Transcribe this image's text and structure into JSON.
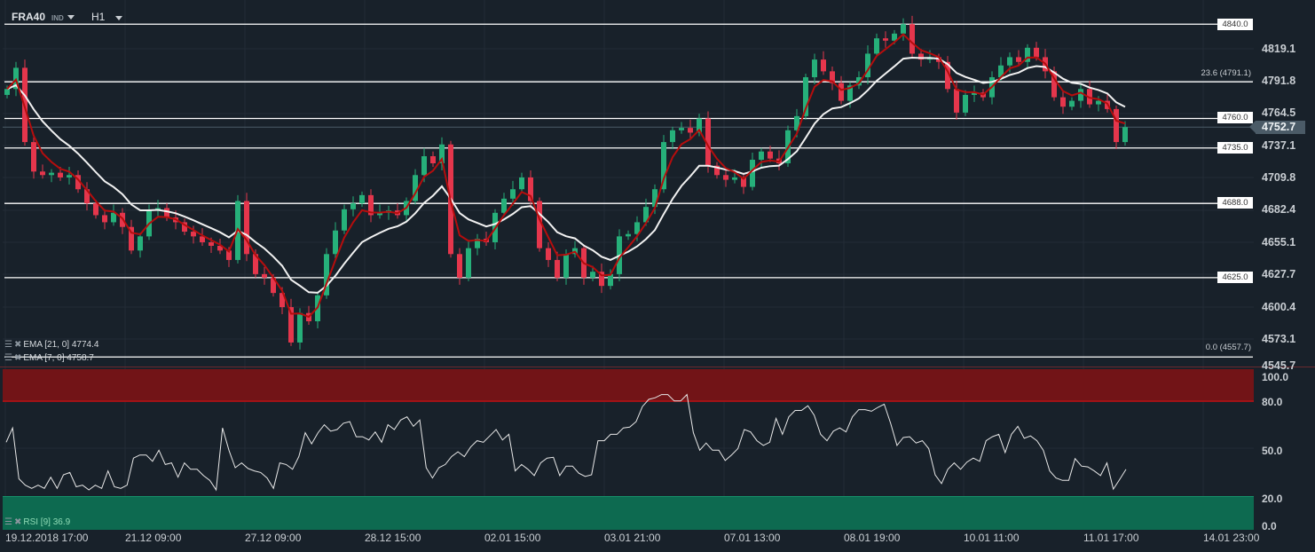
{
  "header": {
    "symbol": "FRA40",
    "instrument_type": "IND",
    "timeframe": "H1"
  },
  "price_axis": [
    "4819.1",
    "4791.8",
    "4764.5",
    "4737.1",
    "4709.8",
    "4682.4",
    "4655.1",
    "4627.7",
    "4600.4",
    "4573.1",
    "4545.7"
  ],
  "levels": [
    {
      "value": 4840.0,
      "label": "4840.0"
    },
    {
      "value": 4760.0,
      "label": "4760.0"
    },
    {
      "value": 4735.0,
      "label": "4735.0"
    },
    {
      "value": 4688.0,
      "label": "4688.0"
    },
    {
      "value": 4625.0,
      "label": "4625.0"
    }
  ],
  "fibonacci": [
    {
      "value": 4791.1,
      "label": "23.6 (4791.1)"
    },
    {
      "value": 4557.7,
      "label": "0.0 (4557.7)"
    }
  ],
  "current_price": "4752.7",
  "indicators": {
    "ema21": "EMA [21, 0] 4774.4",
    "ema7": "EMA [7, 0] 4758.7",
    "rsi": "RSI [9] 36.9"
  },
  "rsi_axis": [
    "100.0",
    "80.0",
    "50.0",
    "20.0",
    "0.0"
  ],
  "time_axis": [
    "19.12.2018  17:00",
    "21.12  09:00",
    "27.12  09:00",
    "28.12  15:00",
    "02.01  15:00",
    "03.01  21:00",
    "07.01  13:00",
    "08.01  19:00",
    "10.01  11:00",
    "11.01  17:00",
    "14.01  23:00"
  ],
  "colors": {
    "up": "#26b07a",
    "down": "#e5364c",
    "ema21": "#f2f2f2",
    "ema7": "#b50d0d",
    "overbought": "#721417",
    "oversold": "#0d6a50"
  },
  "chart_data": {
    "type": "candlestick",
    "symbol": "FRA40",
    "timeframe": "H1",
    "ylim": [
      4545.7,
      4840.0
    ],
    "first_open": 4780,
    "closes": [
      4785,
      4803,
      4740,
      4715,
      4712,
      4714,
      4710,
      4712,
      4700,
      4688,
      4678,
      4672,
      4680,
      4668,
      4648,
      4660,
      4682,
      4684,
      4676,
      4672,
      4664,
      4660,
      4655,
      4652,
      4648,
      4640,
      4690,
      4645,
      4628,
      4625,
      4612,
      4600,
      4570,
      4595,
      4588,
      4610,
      4645,
      4665,
      4683,
      4688,
      4695,
      4678,
      4680,
      4682,
      4678,
      4690,
      4712,
      4728,
      4722,
      4738,
      4645,
      4625,
      4650,
      4658,
      4655,
      4680,
      4692,
      4700,
      4710,
      4690,
      4650,
      4640,
      4625,
      4645,
      4650,
      4625,
      4630,
      4618,
      4628,
      4660,
      4662,
      4672,
      4685,
      4700,
      4740,
      4750,
      4752,
      4748,
      4760,
      4720,
      4712,
      4708,
      4710,
      4702,
      4725,
      4732,
      4726,
      4722,
      4750,
      4762,
      4795,
      4810,
      4800,
      4790,
      4775,
      4788,
      4795,
      4815,
      4828,
      4826,
      4832,
      4840,
      4815,
      4810,
      4812,
      4808,
      4785,
      4765,
      4780,
      4782,
      4778,
      4795,
      4805,
      4812,
      4808,
      4820,
      4812,
      4800,
      4778,
      4770,
      4775,
      4785,
      4772,
      4775,
      4768,
      4740,
      4752.7
    ],
    "ema_periods": [
      21,
      7
    ],
    "rsi_period": 9,
    "rsi_ylim": [
      0,
      100
    ],
    "rsi_bands": [
      20,
      80
    ],
    "rsi": [
      54,
      63,
      31,
      27,
      25,
      27,
      25,
      32,
      25,
      33.5,
      35,
      26,
      27,
      24,
      27,
      25,
      36,
      26,
      25,
      27,
      44,
      46,
      46,
      42,
      49,
      40,
      41,
      32,
      41,
      37,
      37,
      33,
      30,
      24,
      63,
      49,
      38,
      41,
      37.5,
      36,
      35,
      31.5,
      25,
      41,
      40,
      37,
      45,
      60,
      53,
      60,
      65,
      61,
      62,
      66,
      67,
      57.5,
      57.5,
      55.5,
      60.5,
      54,
      65,
      62,
      68,
      70,
      64,
      68,
      38,
      31.5,
      38,
      40,
      45,
      48,
      45,
      51,
      55,
      54,
      58,
      62,
      55.5,
      59,
      36,
      40,
      37,
      33,
      41,
      44,
      44.5,
      33,
      39,
      39,
      34.5,
      32.5,
      33.5,
      55,
      55,
      59,
      59,
      63,
      63.5,
      67,
      76.5,
      81,
      82,
      84,
      84,
      80,
      80,
      84,
      60,
      49,
      53.5,
      49,
      49,
      42.5,
      46,
      50,
      62,
      60.5,
      55,
      52,
      54,
      69,
      59,
      70,
      74,
      74,
      77,
      71,
      59,
      55,
      61,
      63,
      60.5,
      70,
      74.5,
      74.5,
      73.5,
      76,
      78,
      66,
      52,
      57,
      57.5,
      53.5,
      55,
      50,
      33.5,
      28,
      37,
      41,
      37,
      41.5,
      44,
      42,
      55,
      57.5,
      59,
      47.5,
      59,
      64,
      56.5,
      58,
      55,
      49,
      36,
      31.5,
      30,
      30,
      43.7,
      39,
      38.5,
      36,
      33,
      41,
      24.5,
      30.5,
      36.9
    ]
  }
}
